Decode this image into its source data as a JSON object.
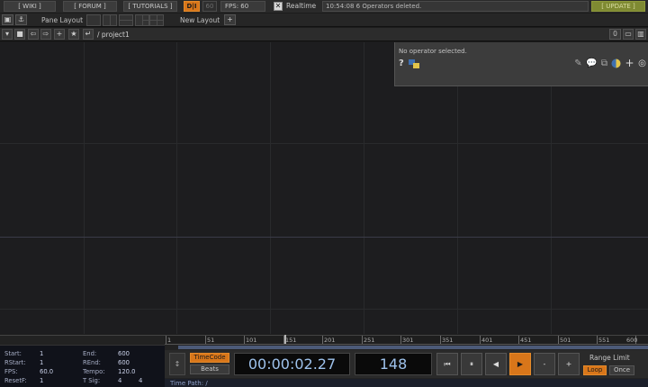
{
  "topbar": {
    "wiki": "[ WIKI ]",
    "forum": "[ FORUM ]",
    "tutorials": "[ TUTORIALS ]",
    "dl": "D|I",
    "sixty": "60",
    "fps": "FPS:  60",
    "realtime": "Realtime",
    "status": "10:54:08 6 Operators deleted.",
    "update": "[ UPDATE ]"
  },
  "layoutbar": {
    "pane_layout": "Pane Layout",
    "new_layout": "New Layout",
    "plus": "+"
  },
  "pathbar": {
    "path": "/ project1",
    "count": "0"
  },
  "params": {
    "no_operator": "No operator selected.",
    "help": "?"
  },
  "timeline": {
    "ticks": [
      "1",
      "51",
      "101",
      "151",
      "201",
      "251",
      "301",
      "351",
      "401",
      "451",
      "501",
      "551",
      "600"
    ],
    "info": {
      "start_label": "Start:",
      "start": "1",
      "end_label": "End:",
      "end": "600",
      "rstart_label": "RStart:",
      "rstart": "1",
      "rend_label": "REnd:",
      "rend": "600",
      "fps_label": "FPS:",
      "fps": "60.0",
      "tempo_label": "Tempo:",
      "tempo": "120.0",
      "resetf_label": "ResetF:",
      "resetf": "1",
      "tsig_label": "T Sig:",
      "tsig_a": "4",
      "tsig_b": "4"
    },
    "timecode": "TimeCode",
    "beats": "Beats",
    "time": "00:00:02.27",
    "frame": "148",
    "minus": "-",
    "plus": "+",
    "range_limit": "Range Limit",
    "loop": "Loop",
    "once": "Once",
    "time_path": "Time Path: /"
  },
  "colors": {
    "accent": "#d8761a",
    "update": "#7f8a32",
    "display_text": "#9ec2ec"
  }
}
